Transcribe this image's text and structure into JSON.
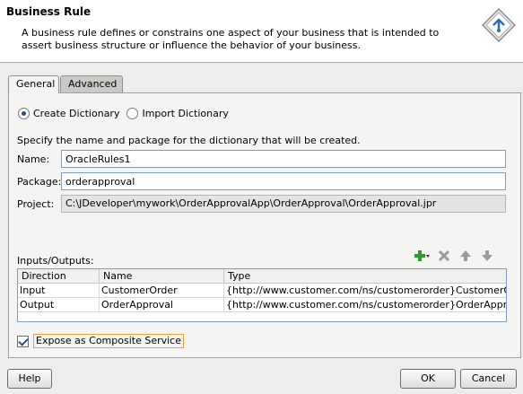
{
  "header": {
    "title": "Business Rule",
    "description": "A business rule defines or constrains one aspect of your business that is intended to assert business structure or influence the behavior of your business.",
    "icon": "business-rule-icon"
  },
  "tabs": [
    {
      "label": "General",
      "active": true
    },
    {
      "label": "Advanced",
      "active": false
    }
  ],
  "general": {
    "create_dictionary_label": "Create Dictionary",
    "import_dictionary_label": "Import Dictionary",
    "selected_option": "Create Dictionary",
    "instruction": "Specify the name and package for the dictionary that will be created.",
    "name_label": "Name:",
    "name_value": "OracleRules1",
    "package_label": "Package:",
    "package_value": "orderapproval",
    "project_label": "Project:",
    "project_value": "C:\\JDeveloper\\mywork\\OrderApprovalApp\\OrderApproval\\OrderApproval.jpr"
  },
  "io": {
    "label": "Inputs/Outputs:",
    "columns": [
      "Direction",
      "Name",
      "Type"
    ],
    "rows": [
      [
        "Input",
        "CustomerOrder",
        "{http://www.customer.com/ns/customerorder}CustomerOrder"
      ],
      [
        "Output",
        "OrderApproval",
        "{http://www.customer.com/ns/customerorder}OrderApproval"
      ]
    ],
    "toolbar_icons": [
      "add-icon",
      "delete-icon",
      "move-up-icon",
      "move-down-icon"
    ]
  },
  "expose": {
    "label": "Expose as Composite Service",
    "checked": true
  },
  "buttons": {
    "help": "Help",
    "ok": "OK",
    "cancel": "Cancel"
  },
  "colors": {
    "accent": "#2a4f8e",
    "add_green": "#2e9a2e",
    "focus_border": "#e9a23b"
  }
}
